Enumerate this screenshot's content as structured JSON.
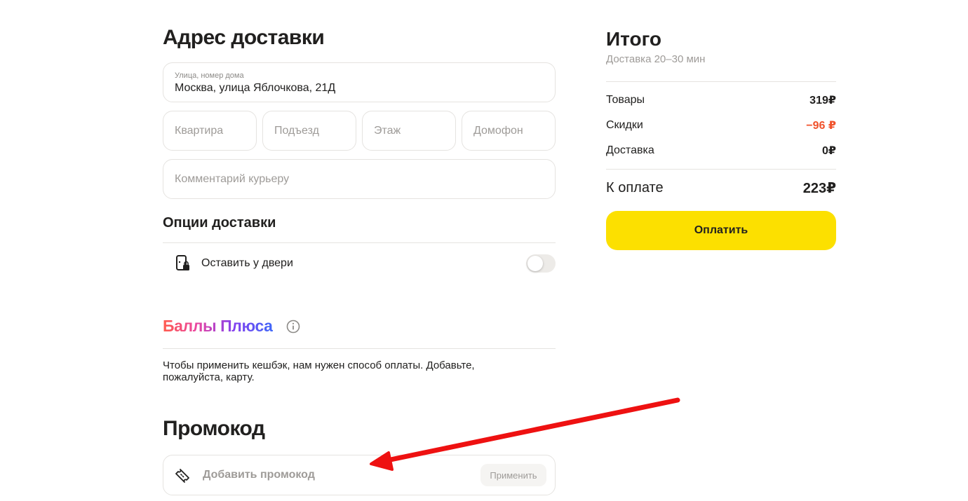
{
  "address": {
    "title": "Адрес доставки",
    "street_label": "Улица, номер дома",
    "street_value": "Москва, улица Яблочкова, 21Д",
    "apartment_placeholder": "Квартира",
    "entrance_placeholder": "Подъезд",
    "floor_placeholder": "Этаж",
    "intercom_placeholder": "Домофон",
    "comment_placeholder": "Комментарий курьеру"
  },
  "options": {
    "title": "Опции доставки",
    "leave_at_door_label": "Оставить у двери",
    "leave_at_door_enabled": false
  },
  "plus": {
    "title": "Баллы Плюса",
    "info_icon": "info-icon",
    "text": "Чтобы применить кешбэк, нам нужен способ оплаты. Добавьте, пожалуйста, карту."
  },
  "promo": {
    "title": "Промокод",
    "placeholder": "Добавить промокод",
    "apply_label": "Применить"
  },
  "summary": {
    "title": "Итого",
    "delivery_time": "Доставка 20–30 мин",
    "goods_label": "Товары",
    "goods_value": "319₽",
    "discount_label": "Скидки",
    "discount_value": "−96 ₽",
    "delivery_label": "Доставка",
    "delivery_value": "0₽",
    "to_pay_label": "К оплате",
    "to_pay_value": "223₽",
    "pay_button": "Оплатить"
  },
  "colors": {
    "accent_yellow": "#fce000",
    "discount_red": "#f0522c",
    "annotation_arrow": "#ee1111"
  }
}
